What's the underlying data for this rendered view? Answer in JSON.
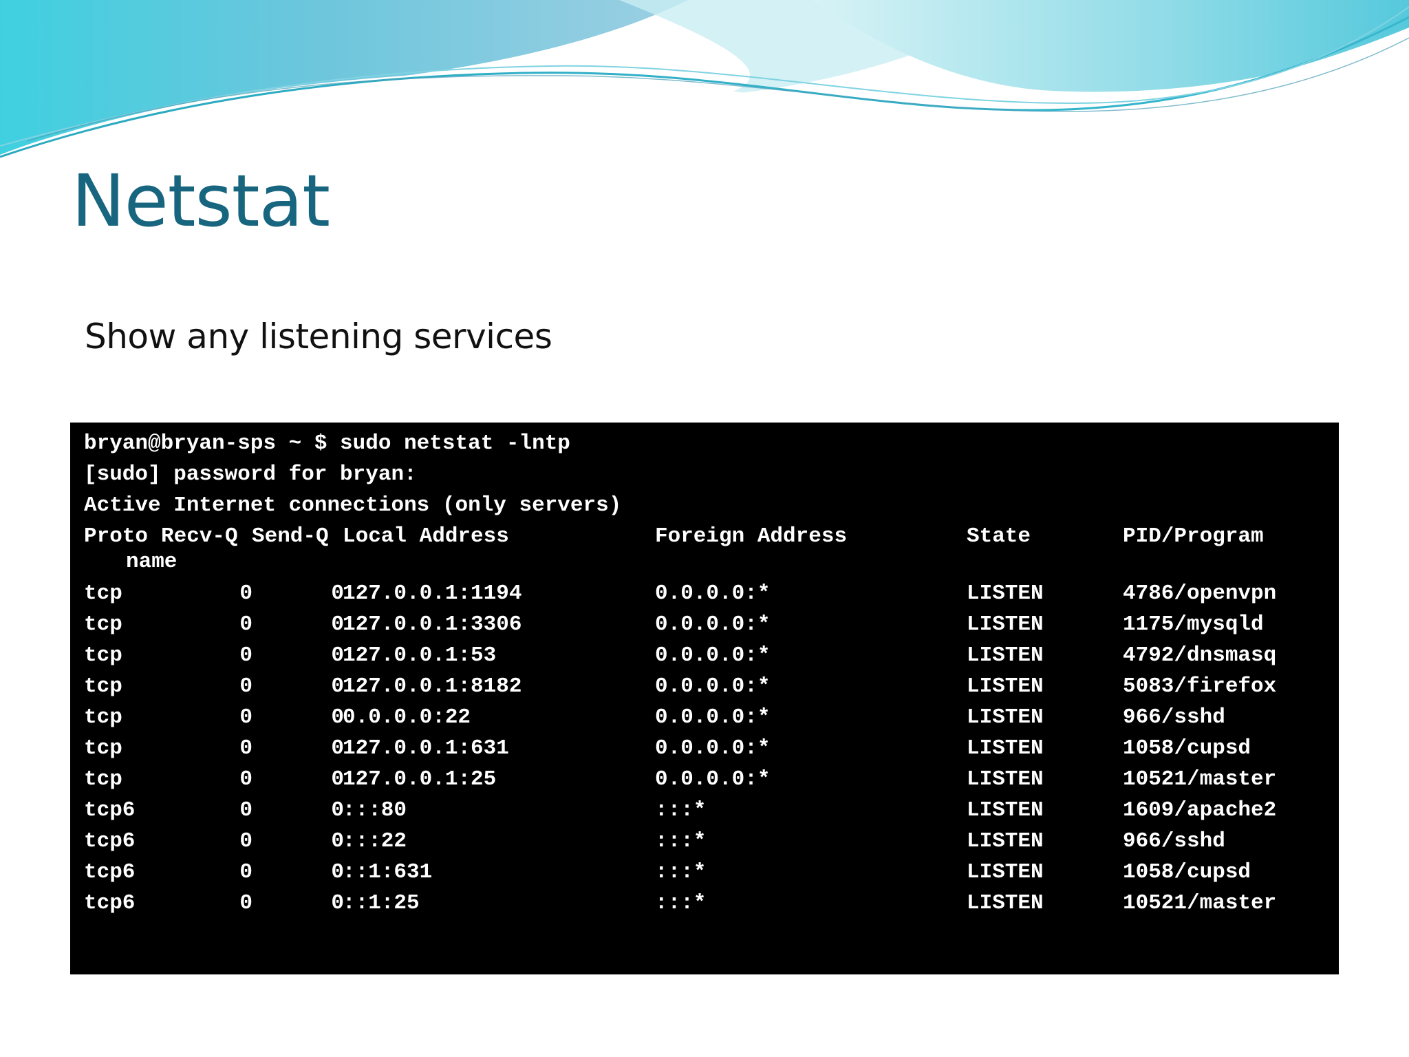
{
  "slide": {
    "title": "Netstat",
    "subtitle": "Show any listening services"
  },
  "terminal": {
    "command_line": "bryan@bryan-sps ~ $ sudo netstat -lntp",
    "sudo_prompt": "[sudo] password for bryan:",
    "info": "Active Internet connections (only servers)",
    "headers": {
      "proto": "Proto",
      "recv_q": "Recv-Q",
      "send_q": "Send-Q",
      "local_address": "Local Address",
      "foreign_address": "Foreign Address",
      "state": "State",
      "pid_program": "PID/Program",
      "pid_program_wrap": "name"
    },
    "rows": [
      {
        "proto": "tcp",
        "recv_q": "0",
        "send_q": "0",
        "local": "127.0.0.1:1194",
        "foreign": "0.0.0.0:*",
        "state": "LISTEN",
        "pid": "4786/openvpn"
      },
      {
        "proto": "tcp",
        "recv_q": "0",
        "send_q": "0",
        "local": "127.0.0.1:3306",
        "foreign": "0.0.0.0:*",
        "state": "LISTEN",
        "pid": "1175/mysqld"
      },
      {
        "proto": "tcp",
        "recv_q": "0",
        "send_q": "0",
        "local": "127.0.0.1:53",
        "foreign": "0.0.0.0:*",
        "state": "LISTEN",
        "pid": "4792/dnsmasq"
      },
      {
        "proto": "tcp",
        "recv_q": "0",
        "send_q": "0",
        "local": "127.0.0.1:8182",
        "foreign": "0.0.0.0:*",
        "state": "LISTEN",
        "pid": "5083/firefox"
      },
      {
        "proto": "tcp",
        "recv_q": "0",
        "send_q": "0",
        "local": "0.0.0.0:22",
        "foreign": "0.0.0.0:*",
        "state": "LISTEN",
        "pid": "966/sshd"
      },
      {
        "proto": "tcp",
        "recv_q": "0",
        "send_q": "0",
        "local": "127.0.0.1:631",
        "foreign": "0.0.0.0:*",
        "state": "LISTEN",
        "pid": "1058/cupsd"
      },
      {
        "proto": "tcp",
        "recv_q": "0",
        "send_q": "0",
        "local": "127.0.0.1:25",
        "foreign": "0.0.0.0:*",
        "state": "LISTEN",
        "pid": "10521/master"
      },
      {
        "proto": "tcp6",
        "recv_q": "0",
        "send_q": "0",
        "local": ":::80",
        "foreign": ":::*",
        "state": "LISTEN",
        "pid": "1609/apache2"
      },
      {
        "proto": "tcp6",
        "recv_q": "0",
        "send_q": "0",
        "local": ":::22",
        "foreign": ":::*",
        "state": "LISTEN",
        "pid": "966/sshd"
      },
      {
        "proto": "tcp6",
        "recv_q": "0",
        "send_q": "0",
        "local": "::1:631",
        "foreign": ":::*",
        "state": "LISTEN",
        "pid": "1058/cupsd"
      },
      {
        "proto": "tcp6",
        "recv_q": "0",
        "send_q": "0",
        "local": "::1:25",
        "foreign": ":::*",
        "state": "LISTEN",
        "pid": "10521/master"
      }
    ]
  },
  "colors": {
    "title": "#17657f",
    "terminal_bg": "#000000",
    "terminal_text": "#ffffff",
    "wave_light": "#9fe3ec",
    "wave_teal": "#1f8fa6"
  }
}
